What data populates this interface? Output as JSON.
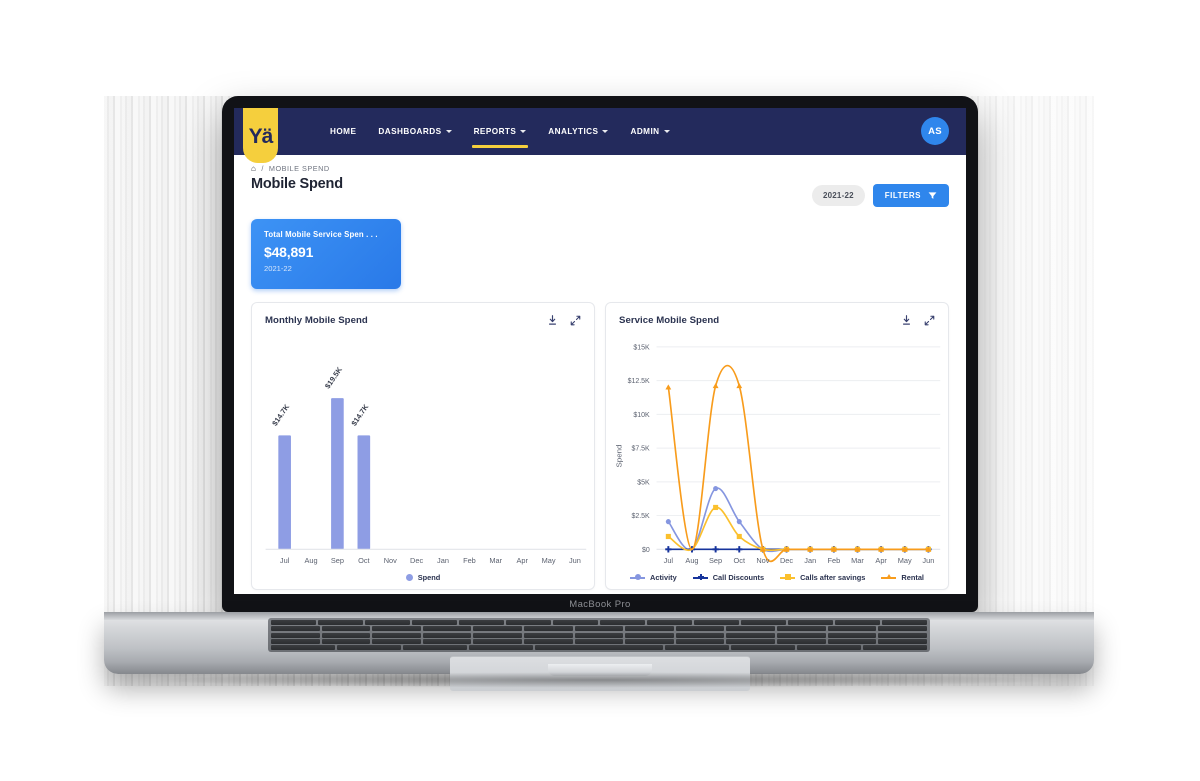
{
  "device": {
    "model_label": "MacBook Pro"
  },
  "navbar": {
    "logo_text": "Yä",
    "items": [
      {
        "label": "HOME",
        "has_caret": false,
        "active": false
      },
      {
        "label": "DASHBOARDS",
        "has_caret": true,
        "active": false
      },
      {
        "label": "REPORTS",
        "has_caret": true,
        "active": true
      },
      {
        "label": "ANALYTICS",
        "has_caret": true,
        "active": false
      },
      {
        "label": "ADMIN",
        "has_caret": true,
        "active": false
      }
    ],
    "avatar_initials": "AS"
  },
  "breadcrumb": {
    "home_icon": "home-icon",
    "separator": "/",
    "current": "MOBILE SPEND"
  },
  "header": {
    "title": "Mobile Spend",
    "year_chip": "2021-22",
    "filters_label": "FILTERS"
  },
  "kpi": {
    "label": "Total Mobile Service Spen . . .",
    "value": "$48,891",
    "period": "2021-22"
  },
  "colors": {
    "navy": "#232a5c",
    "accent_yellow": "#f5cf3d",
    "blue": "#2f86ec",
    "bar_blue": "#8e9de4",
    "activity": "#8596e0",
    "call_discounts": "#17349c",
    "calls_after_savings": "#fbc02d",
    "rental": "#f89c1c"
  },
  "cards": [
    {
      "title": "Monthly Mobile Spend",
      "download_icon": "download-icon",
      "expand_icon": "expand-icon"
    },
    {
      "title": "Service Mobile Spend",
      "download_icon": "download-icon",
      "expand_icon": "expand-icon"
    }
  ],
  "chart_data": [
    {
      "type": "bar",
      "title": "Monthly Mobile Spend",
      "xlabel": "",
      "ylabel": "",
      "categories": [
        "Jul",
        "Aug",
        "Sep",
        "Oct",
        "Nov",
        "Dec",
        "Jan",
        "Feb",
        "Mar",
        "Apr",
        "May",
        "Jun"
      ],
      "values": [
        14700,
        0,
        19500,
        14700,
        0,
        0,
        0,
        0,
        0,
        0,
        0,
        0
      ],
      "point_labels": [
        "$14.7K",
        "",
        "$19.5K",
        "$14.7K",
        "",
        "",
        "",
        "",
        "",
        "",
        "",
        ""
      ],
      "ylim": [
        0,
        21000
      ],
      "grid": false,
      "legend": [
        {
          "name": "Spend",
          "color": "#8e9de4",
          "marker": "circle"
        }
      ],
      "legend_position": "bottom"
    },
    {
      "type": "line",
      "title": "Service Mobile Spend",
      "xlabel": "",
      "ylabel": "Spend",
      "x": [
        "Jul",
        "Aug",
        "Sep",
        "Oct",
        "Nov",
        "Dec",
        "Jan",
        "Feb",
        "Mar",
        "Apr",
        "May",
        "Jun"
      ],
      "ylim": [
        0,
        15000
      ],
      "yticks": [
        0,
        2500,
        5000,
        7500,
        10000,
        12500,
        15000
      ],
      "ytick_labels": [
        "$0",
        "$2.5K",
        "$5K",
        "$7.5K",
        "$10K",
        "$12.5K",
        "$15K"
      ],
      "grid": true,
      "legend_position": "bottom",
      "series": [
        {
          "name": "Activity",
          "color": "#8596e0",
          "marker": "circle",
          "values": [
            2050,
            0,
            4500,
            2050,
            0,
            0,
            0,
            0,
            0,
            0,
            0,
            0
          ]
        },
        {
          "name": "Call Discounts",
          "color": "#17349c",
          "marker": "plus",
          "values": [
            0,
            0,
            0,
            0,
            0,
            0,
            0,
            0,
            0,
            0,
            0,
            0
          ]
        },
        {
          "name": "Calls after savings",
          "color": "#fbc02d",
          "marker": "square",
          "values": [
            950,
            0,
            3100,
            950,
            0,
            0,
            0,
            0,
            0,
            0,
            0,
            0
          ]
        },
        {
          "name": "Rental",
          "color": "#f89c1c",
          "marker": "triangle",
          "values": [
            12000,
            0,
            12100,
            12100,
            0,
            0,
            0,
            0,
            0,
            0,
            0,
            0
          ]
        }
      ]
    }
  ]
}
